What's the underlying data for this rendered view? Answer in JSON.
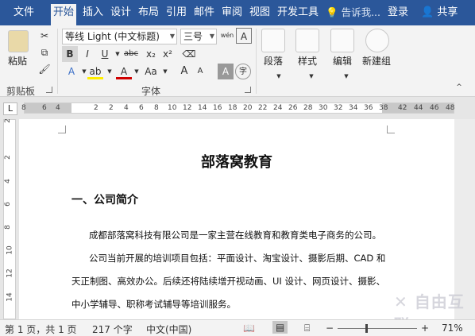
{
  "tabs": [
    "文件",
    "开始",
    "插入",
    "设计",
    "布局",
    "引用",
    "邮件",
    "审阅",
    "视图",
    "开发工具"
  ],
  "tell_me": "告诉我...",
  "login": "登录",
  "share": "共享",
  "ribbon": {
    "paste": "粘贴",
    "clipboard": "剪贴板",
    "font_name": "等线 Light (中文标题)",
    "font_size": "三号",
    "font_group": "字体",
    "bold": "B",
    "italic": "I",
    "underline": "U",
    "strike": "abc",
    "subscript": "x₂",
    "superscript": "x²",
    "font_color": "A",
    "change_case": "Aa",
    "grow": "A",
    "shrink": "A",
    "paragraph": "段落",
    "styles": "样式",
    "editing": "编辑",
    "new_group": "新建组",
    "phonetic": "wén"
  },
  "ruler": {
    "tab_selector": "L",
    "numbers": [
      "8",
      "6",
      "4",
      "2",
      "2",
      "4",
      "6",
      "8",
      "10",
      "12",
      "14",
      "16",
      "18",
      "20",
      "22",
      "24",
      "26",
      "28",
      "30",
      "32",
      "34",
      "36",
      "38",
      "42",
      "44",
      "46",
      "48"
    ]
  },
  "vruler": [
    "2",
    "2",
    "4",
    "6",
    "8",
    "10",
    "12",
    "14"
  ],
  "document": {
    "title": "部落窝教育",
    "heading": "一、公司简介",
    "paragraphs": [
      "成都部落窝科技有限公司是一家主营在线教育和教育类电子商务的公司。",
      "公司当前开展的培训项目包括：平面设计、淘宝设计、摄影后期、CAD 和",
      "天正制图、高效办公。后续还将陆续增开视动画、UI 设计、网页设计、摄影、",
      "中小学辅导、职称考试辅导等培训服务。"
    ]
  },
  "status": {
    "page": "第 1 页，共 1 页",
    "words": "217 个字",
    "lang": "中文(中国)",
    "zoom": "71%",
    "minus": "−",
    "plus": "+"
  },
  "watermark": "自由互联"
}
